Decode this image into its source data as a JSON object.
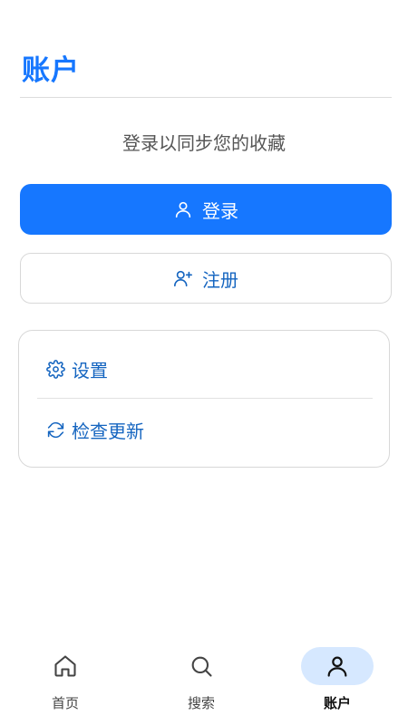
{
  "header": {
    "title": "账户"
  },
  "prompt": {
    "text": "登录以同步您的收藏"
  },
  "buttons": {
    "login_label": "登录",
    "register_label": "注册"
  },
  "menu": {
    "items": [
      {
        "label": "设置",
        "icon": "gear-icon"
      },
      {
        "label": "检查更新",
        "icon": "refresh-icon"
      }
    ]
  },
  "bottom_nav": {
    "items": [
      {
        "label": "首页",
        "icon": "home-icon",
        "active": false
      },
      {
        "label": "搜索",
        "icon": "search-icon",
        "active": false
      },
      {
        "label": "账户",
        "icon": "user-icon",
        "active": true
      }
    ]
  },
  "colors": {
    "accent": "#1677ff",
    "link": "#1565c0",
    "active_nav_bg": "#d6e8ff"
  }
}
